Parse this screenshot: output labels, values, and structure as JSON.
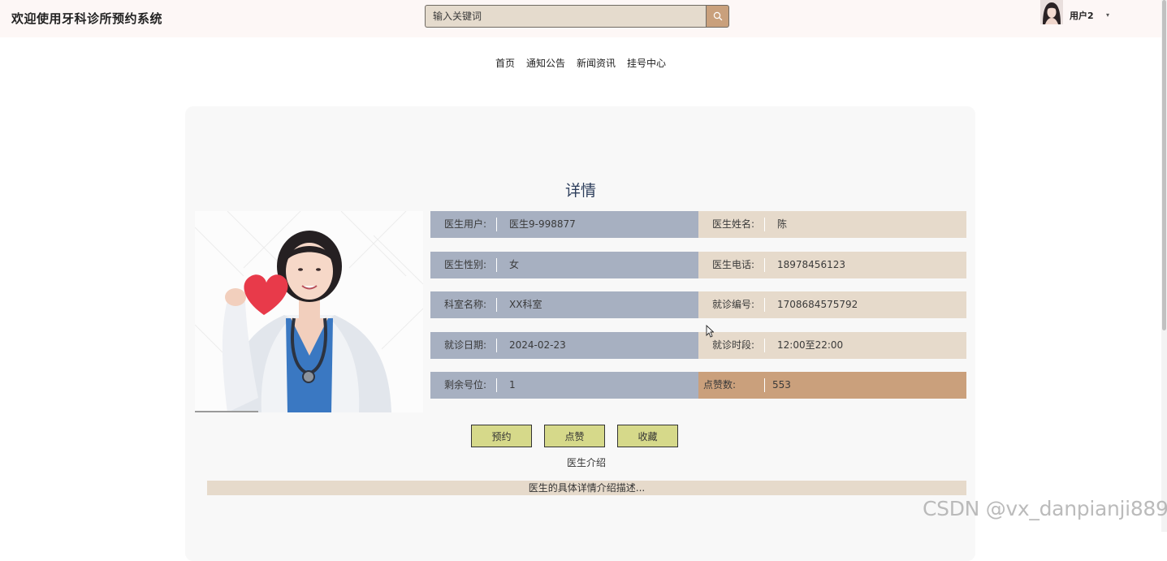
{
  "header": {
    "app_title": "欢迎使用牙科诊所预约系统",
    "search_placeholder": "输入关键词",
    "search_icon": "search-icon",
    "user_name": "用户2",
    "user_caret": "▾"
  },
  "nav": {
    "items": [
      {
        "label": "首页"
      },
      {
        "label": "通知公告"
      },
      {
        "label": "新闻资讯"
      },
      {
        "label": "挂号中心"
      }
    ]
  },
  "detail": {
    "title": "详情",
    "rows": [
      {
        "left": {
          "label": "医生用户:",
          "value": "医生9-998877"
        },
        "right": {
          "label": "医生姓名:",
          "value": "陈"
        }
      },
      {
        "left": {
          "label": "医生性别:",
          "value": "女"
        },
        "right": {
          "label": "医生电话:",
          "value": "18978456123"
        }
      },
      {
        "left": {
          "label": "科室名称:",
          "value": "XX科室"
        },
        "right": {
          "label": "就诊编号:",
          "value": "1708684575792"
        }
      },
      {
        "left": {
          "label": "就诊日期:",
          "value": "2024-02-23"
        },
        "right": {
          "label": "就诊时段:",
          "value": "12:00至22:00"
        }
      },
      {
        "left": {
          "label": "剩余号位:",
          "value": "1"
        },
        "right": {
          "label": "点赞数:",
          "value": "553"
        }
      }
    ],
    "buttons": {
      "book": "预约",
      "like": "点赞",
      "favorite": "收藏"
    },
    "intro_heading": "医生介绍",
    "intro_text": "医生的具体详情介绍描述..."
  },
  "watermark": "CSDN @vx_danpianji889",
  "colors": {
    "header_bg": "#fdf7f6",
    "search_bg": "#e5dbcd",
    "search_button": "#c9a07c",
    "left_cell": "#a7b0c1",
    "right_cell": "#e6dacb",
    "likes_cell": "#caa07c",
    "button_bg": "#d6d98a",
    "title_color": "#2d3e5c"
  }
}
